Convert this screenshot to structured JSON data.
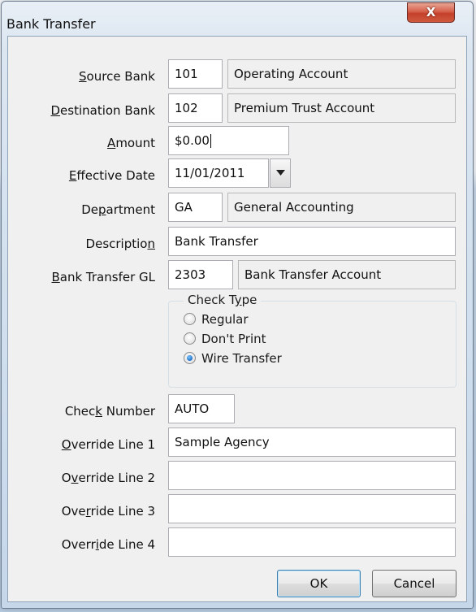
{
  "window": {
    "title": "Bank Transfer",
    "close_glyph": "X"
  },
  "form": {
    "source_bank": {
      "label_pre": "",
      "label_mn": "S",
      "label_post": "ource Bank",
      "code": "101",
      "name": "Operating Account"
    },
    "destination_bank": {
      "label_pre": "",
      "label_mn": "D",
      "label_post": "estination Bank",
      "code": "102",
      "name": "Premium Trust Account"
    },
    "amount": {
      "label_pre": "",
      "label_mn": "A",
      "label_post": "mount",
      "value": "$0.00"
    },
    "effective_date": {
      "label_pre": "",
      "label_mn": "E",
      "label_post": "ffective Date",
      "value": "11/01/2011"
    },
    "department": {
      "label_pre": "De",
      "label_mn": "p",
      "label_post": "artment",
      "code": "GA",
      "name": "General Accounting"
    },
    "description": {
      "label_pre": "Descriptio",
      "label_mn": "n",
      "label_post": "",
      "value": "Bank Transfer"
    },
    "bank_transfer_gl": {
      "label_pre": "",
      "label_mn": "B",
      "label_post": "ank Transfer GL",
      "code": "2303",
      "name": "Bank Transfer Account"
    },
    "check_type": {
      "title_pre": "Check T",
      "title_mn": "y",
      "title_post": "pe",
      "options": [
        {
          "label": "Regular",
          "selected": false
        },
        {
          "label": "Don't Print",
          "selected": false
        },
        {
          "label": "Wire Transfer",
          "selected": true
        }
      ]
    },
    "check_number": {
      "label_pre": "Chec",
      "label_mn": "k",
      "label_post": " Number",
      "value": "AUTO"
    },
    "override_lines": [
      {
        "label_pre": "",
        "label_mn": "O",
        "label_post": "verride Line 1",
        "value": "Sample Agency"
      },
      {
        "label_pre": "O",
        "label_mn": "v",
        "label_post": "erride Line 2",
        "value": ""
      },
      {
        "label_pre": "Ove",
        "label_mn": "r",
        "label_post": "ride Line 3",
        "value": ""
      },
      {
        "label_pre": "Overr",
        "label_mn": "i",
        "label_post": "de Line 4",
        "value": ""
      }
    ]
  },
  "buttons": {
    "ok": "OK",
    "cancel": "Cancel"
  },
  "icons": {
    "date_dropdown": "chevron-down-icon",
    "close": "close-icon"
  },
  "colors": {
    "close_button": "#c4402a",
    "radio_selected": "#1c6fc7",
    "default_button_border": "#3c7fb1"
  }
}
